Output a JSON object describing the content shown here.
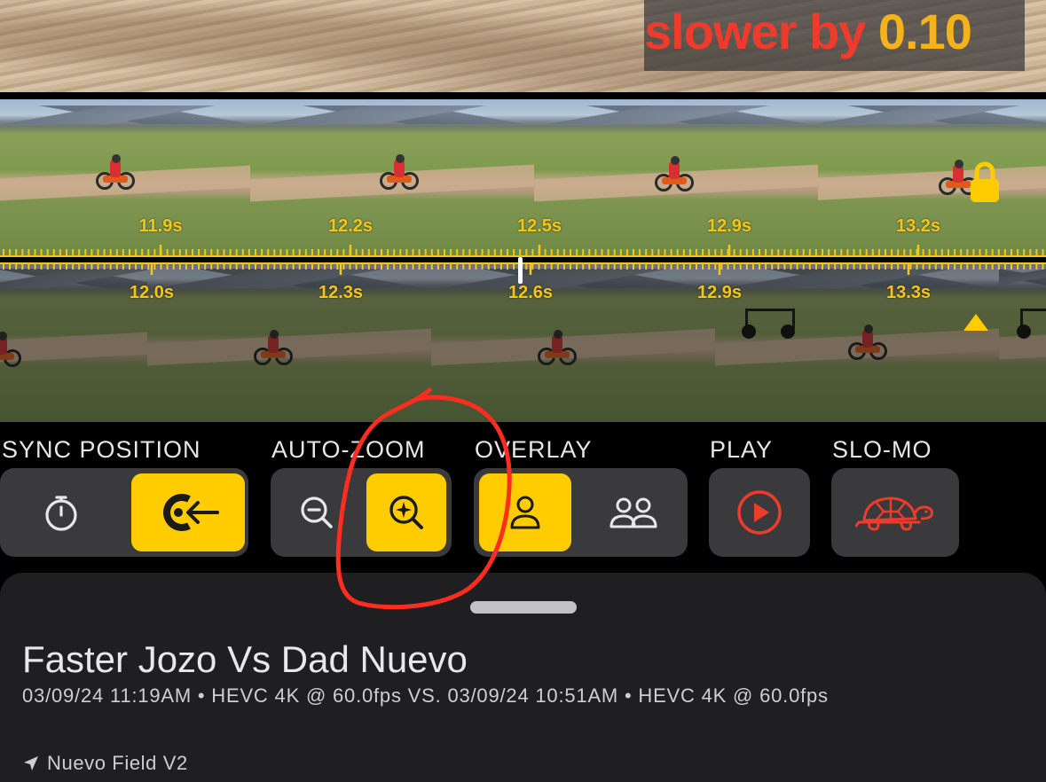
{
  "overlay_text": {
    "slower_word": "slower by",
    "slower_value": "0.10"
  },
  "timeline_top": {
    "ticks": [
      "11.9s",
      "12.2s",
      "12.5s",
      "12.9s",
      "13.2s"
    ]
  },
  "timeline_bottom": {
    "ticks": [
      "12.0s",
      "12.3s",
      "12.6s",
      "12.9s",
      "13.3s"
    ]
  },
  "icons": {
    "lock": "lock-icon",
    "triangle": "triangle-up-icon",
    "stopwatch": "stopwatch-icon",
    "sync_target": "sync-target-icon",
    "zoom_out": "zoom-out-icon",
    "zoom_auto": "zoom-auto-icon",
    "person": "person-icon",
    "people": "people-icon",
    "play": "play-icon",
    "turtle": "turtle-icon",
    "location": "location-arrow-icon"
  },
  "controls": {
    "sync_position": {
      "label": "SYNC POSITION"
    },
    "auto_zoom": {
      "label": "AUTO-ZOOM"
    },
    "overlay": {
      "label": "OVERLAY"
    },
    "play": {
      "label": "PLAY"
    },
    "slo_mo": {
      "label": "SLO-MO"
    }
  },
  "sheet": {
    "title": "Faster Jozo Vs Dad Nuevo",
    "subtitle": "03/09/24 11:19AM • HEVC 4K @ 60.0fps VS. 03/09/24 10:51AM • HEVC 4K @ 60.0fps",
    "location": "Nuevo Field V2"
  },
  "colors": {
    "accent_yellow": "#ffcc00",
    "red": "#ef3b2c",
    "orange": "#f6b21a",
    "control_bg": "#3a3a3c",
    "sheet_bg": "#1f1f21",
    "annotation_red": "#ff2d20"
  }
}
